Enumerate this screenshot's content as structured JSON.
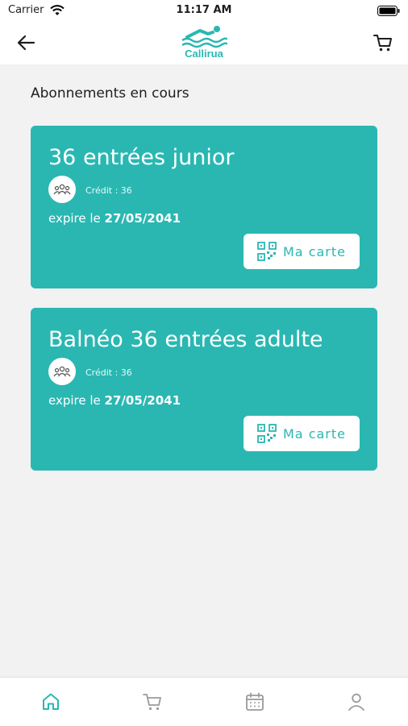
{
  "status_bar": {
    "carrier": "Carrier",
    "time": "11:17 AM"
  },
  "header": {
    "logo_text": "Callirua",
    "back_icon": "arrow-left-icon",
    "cart_icon": "cart-icon"
  },
  "section_title": "Abonnements en cours",
  "cards": [
    {
      "title": "36 entrées junior",
      "credit": "Crédit : 36",
      "expire_prefix": "expire le",
      "expire_date": "27/05/2041",
      "button_label": "Ma carte"
    },
    {
      "title": "Balnéo 36 entrées adulte",
      "credit": "Crédit : 36",
      "expire_prefix": "expire le",
      "expire_date": "27/05/2041",
      "button_label": "Ma carte"
    }
  ],
  "tabs": [
    {
      "name": "home",
      "icon": "home-icon",
      "active": true
    },
    {
      "name": "cart",
      "icon": "cart-icon",
      "active": false
    },
    {
      "name": "calendar",
      "icon": "calendar-icon",
      "active": false
    },
    {
      "name": "profile",
      "icon": "user-icon",
      "active": false
    }
  ],
  "colors": {
    "accent": "#2ab7b2",
    "background": "#f2f2f2",
    "text": "#1e1e1e",
    "inactive_icon": "#9a9a9a"
  }
}
